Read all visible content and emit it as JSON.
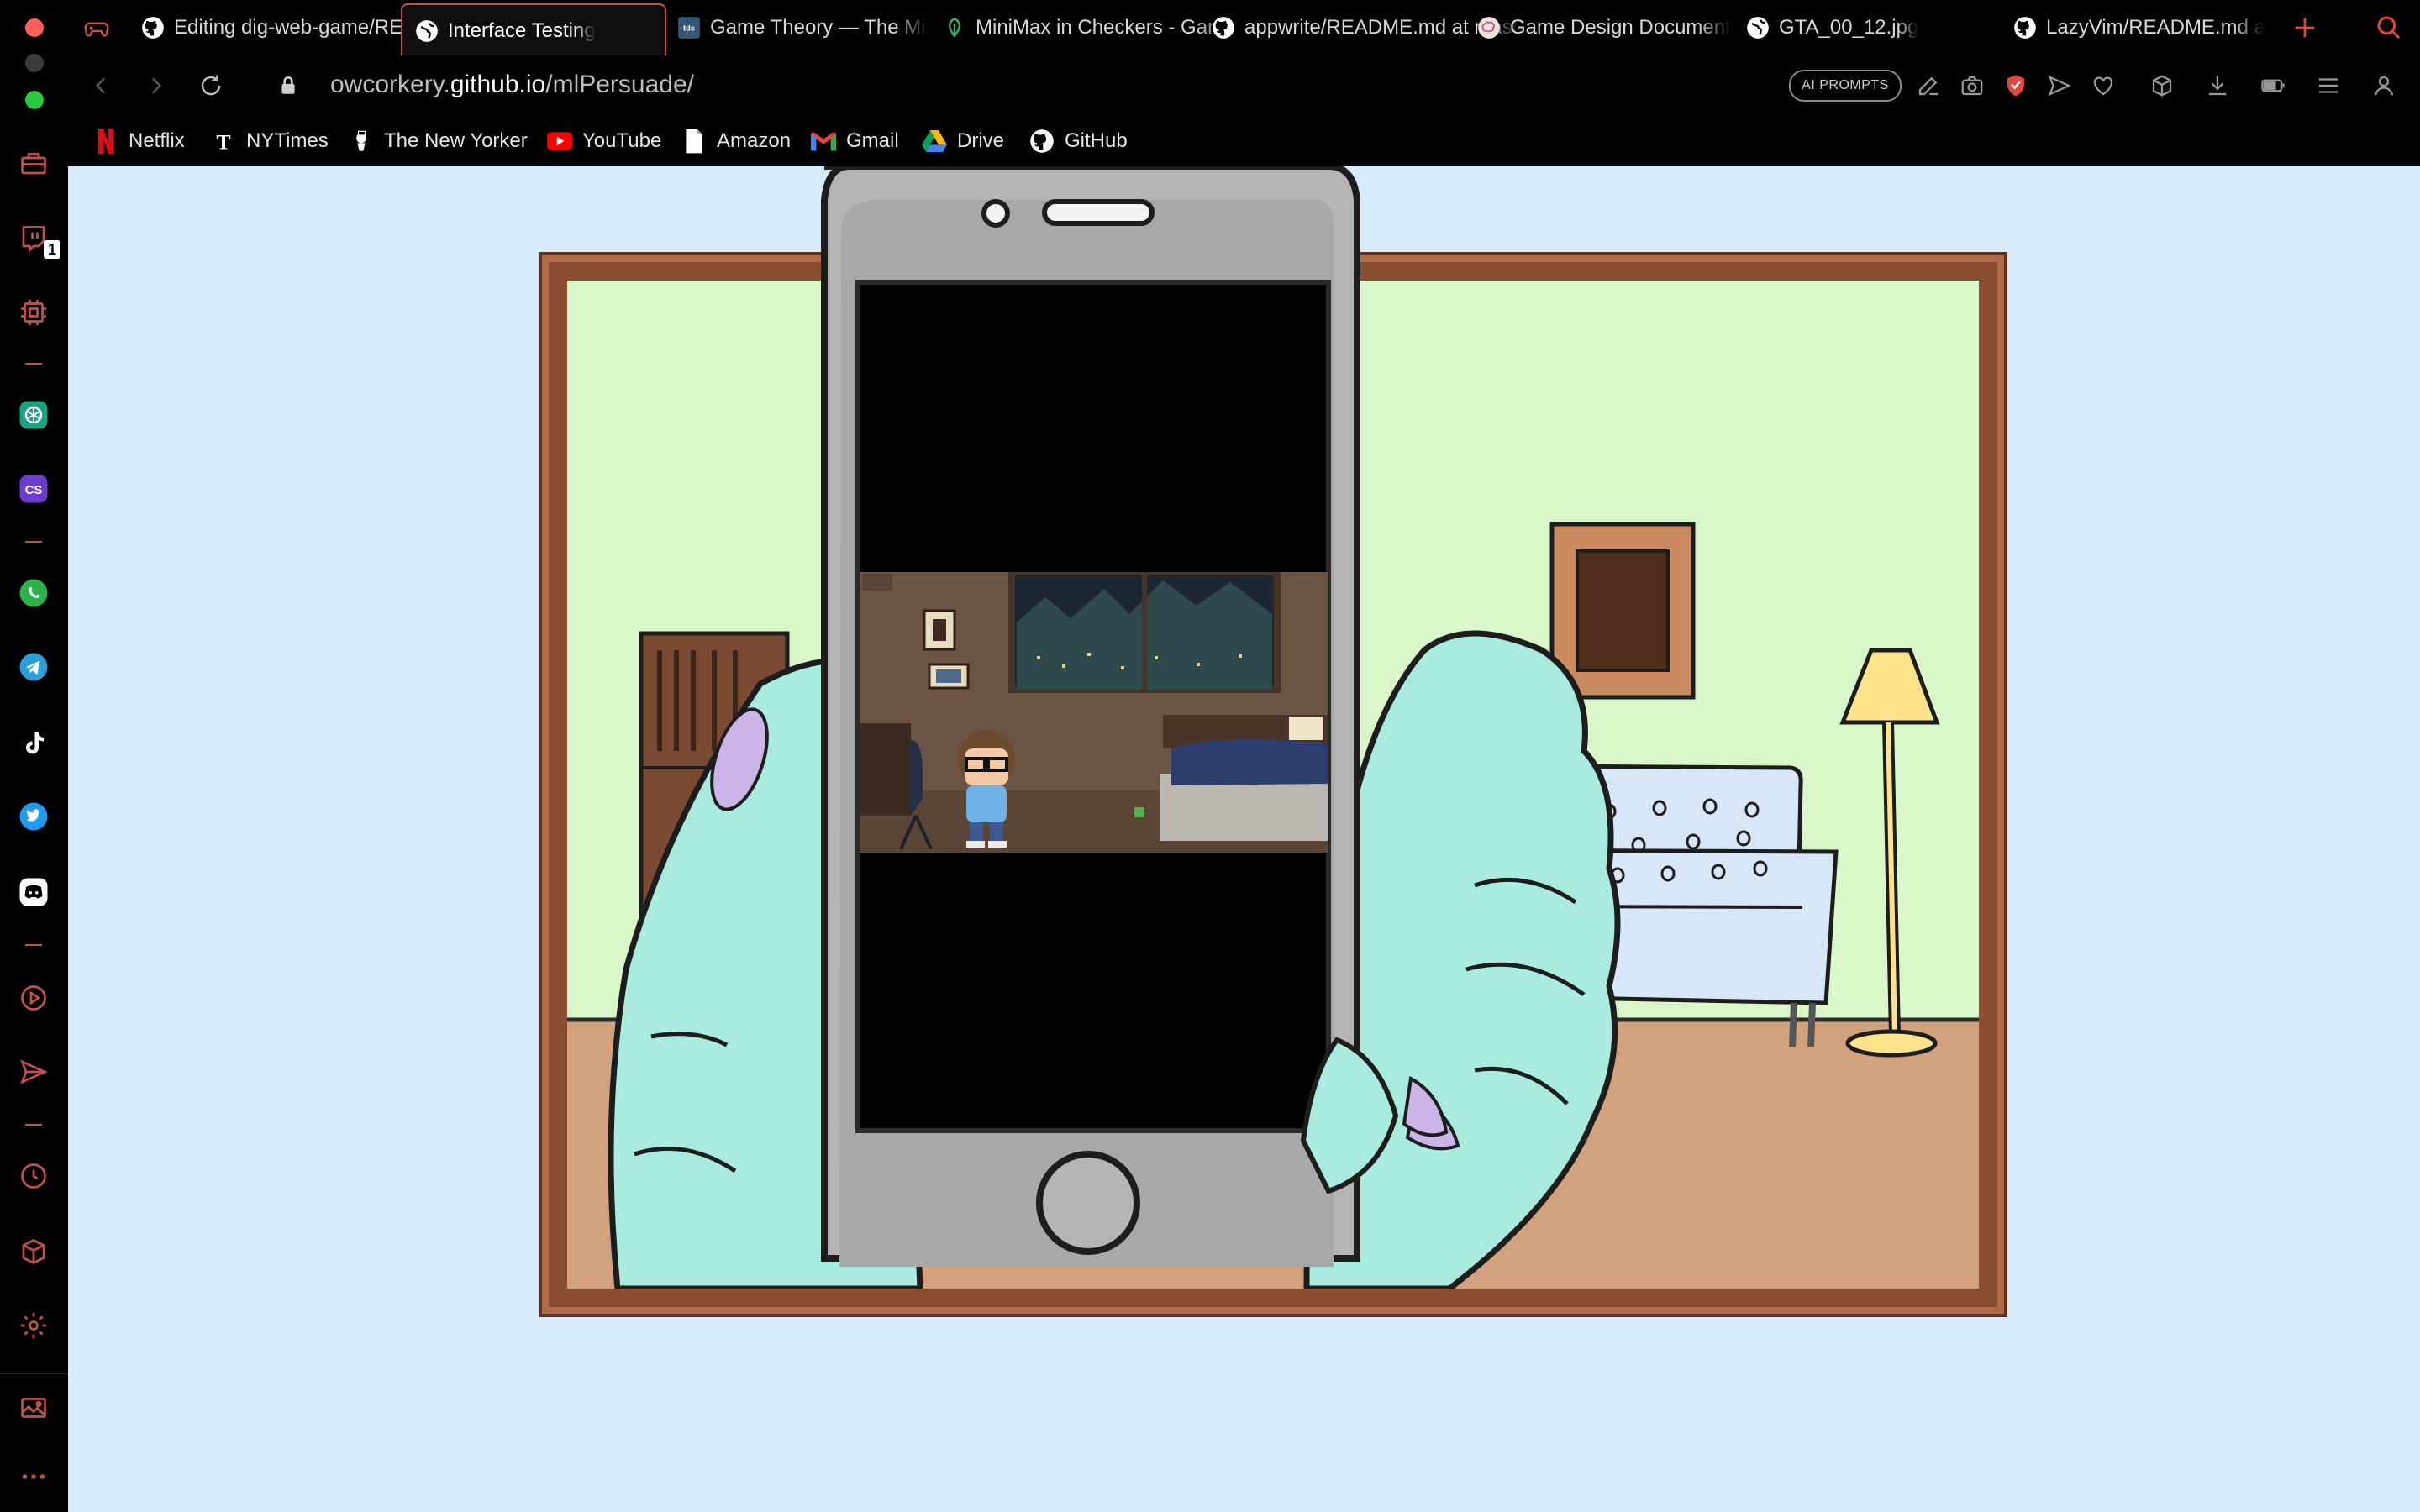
{
  "window": {
    "traffic_colors": [
      "#ff5f57",
      "#3a3a3a",
      "#28c840"
    ]
  },
  "tabs": [
    {
      "title": "Editing dig-web-game/README.md at main",
      "icon": "github-icon"
    },
    {
      "title": "Interface Testing",
      "icon": "globe-icon",
      "active": true
    },
    {
      "title": "Game Theory — The Minimax Algorithm",
      "icon": "tds-icon"
    },
    {
      "title": "MiniMax in Checkers - Game",
      "icon": "leaf-icon"
    },
    {
      "title": "appwrite/README.md at master",
      "icon": "github-icon"
    },
    {
      "title": "Game Design Document",
      "icon": "brain-icon"
    },
    {
      "title": "GTA_00_12.jpg",
      "icon": "globe-icon"
    },
    {
      "title": "LazyVim/README.md at main",
      "icon": "github-icon"
    }
  ],
  "address": {
    "url_prefix": "owcorkery.",
    "url_domain": "github.io",
    "url_path": "/mlPersuade/",
    "ai_prompts": "AI PROMPTS"
  },
  "bookmarks": [
    {
      "label": "Netflix",
      "icon": "netflix-icon"
    },
    {
      "label": "NYTimes",
      "icon": "nytimes-icon"
    },
    {
      "label": "The New Yorker",
      "icon": "new-yorker-icon"
    },
    {
      "label": "YouTube",
      "icon": "youtube-icon"
    },
    {
      "label": "Amazon",
      "icon": "document-icon"
    },
    {
      "label": "Gmail",
      "icon": "gmail-icon"
    },
    {
      "label": "Drive",
      "icon": "drive-icon"
    },
    {
      "label": "GitHub",
      "icon": "github-icon"
    }
  ],
  "sidebar": {
    "twitch_badge": "1",
    "items": [
      "toolbox-icon",
      "twitch-icon",
      "cpu-icon",
      "chatgpt-icon",
      "cs-icon",
      "whatsapp-icon",
      "telegram-icon",
      "tiktok-icon",
      "twitter-icon",
      "discord-icon",
      "player-icon",
      "send-icon",
      "history-icon",
      "cube-icon",
      "settings-icon",
      "gallery-icon",
      "more-icon"
    ]
  },
  "colors": {
    "accent": "#c2514b",
    "page_bg": "#d8ebfb",
    "frame": "#8a4f32",
    "wall": "#d9f7c9",
    "floor": "#d2a27f",
    "hand": "#a9ecdf",
    "phone": "#b5b5b5"
  }
}
